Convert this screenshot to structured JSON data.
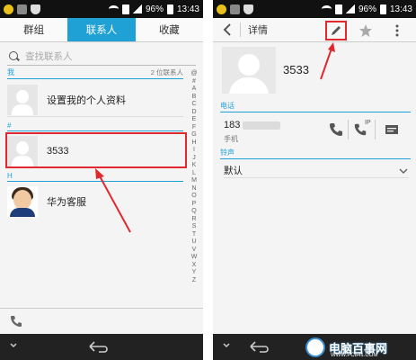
{
  "status_bar": {
    "battery": "96%",
    "time": "13:43"
  },
  "left": {
    "tabs": [
      {
        "label": "群组",
        "active": false
      },
      {
        "label": "联系人",
        "active": true
      },
      {
        "label": "收藏",
        "active": false
      }
    ],
    "search": {
      "placeholder": "查找联系人"
    },
    "sections": [
      {
        "letter": "我",
        "count": "2 位联系人"
      },
      {
        "letter": "#"
      },
      {
        "letter": "H"
      }
    ],
    "contacts": [
      {
        "name": "设置我的个人资料"
      },
      {
        "name": "3533"
      },
      {
        "name": "华为客服"
      }
    ],
    "alpha_index": [
      "@",
      "#",
      "A",
      "B",
      "C",
      "D",
      "E",
      "F",
      "G",
      "H",
      "I",
      "J",
      "K",
      "L",
      "M",
      "N",
      "O",
      "P",
      "Q",
      "R",
      "S",
      "T",
      "U",
      "V",
      "W",
      "X",
      "Y",
      "Z"
    ]
  },
  "right": {
    "title": "详情",
    "contact_name": "3533",
    "phone_section": "电话",
    "phone_number_prefix": "183",
    "phone_type": "手机",
    "ringtone_section": "铃声",
    "ringtone_value": "默认",
    "ip_label": "IP"
  },
  "watermark": {
    "main": "电脑百事网",
    "sub": "WWW.PC841.COM"
  },
  "colors": {
    "accent": "#1fa1d6",
    "highlight": "#e0282e"
  }
}
